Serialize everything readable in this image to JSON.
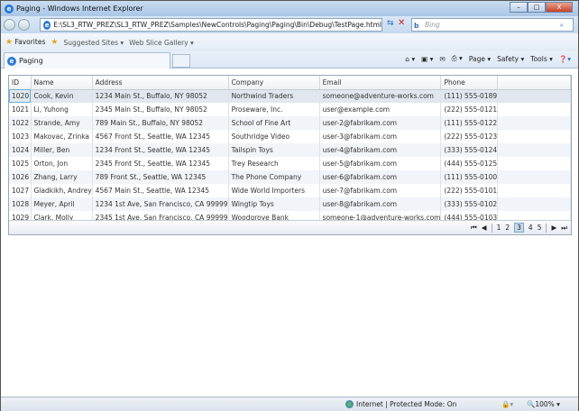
{
  "window": {
    "title": "Paging - Windows Internet Explorer",
    "min": "–",
    "max": "□",
    "close": "X"
  },
  "address": {
    "url": "E:\\SL3_RTW_PREZ\\SL3_RTW_PREZ\\Samples\\NewControls\\Paging\\Paging\\Bin\\Debug\\TestPage.html",
    "search_placeholder": "Bing"
  },
  "favorites": {
    "label": "Favorites",
    "items": [
      "Suggested Sites ▾",
      "Web Slice Gallery ▾"
    ]
  },
  "tab": {
    "label": "Paging"
  },
  "commandbar": [
    "Page ▾",
    "Safety ▾",
    "Tools ▾"
  ],
  "grid": {
    "columns": [
      "ID",
      "Name",
      "Address",
      "Company",
      "Email",
      "Phone"
    ],
    "rows": [
      [
        "1020",
        "Cook, Kevin",
        "1234 Main St., Buffalo, NY 98052",
        "Northwind Traders",
        "someone@adventure-works.com",
        "(111) 555-0189"
      ],
      [
        "1021",
        "Li, Yuhong",
        "2345 Main St., Buffalo, NY 98052",
        "Proseware, Inc.",
        "user@example.com",
        "(222) 555-0121"
      ],
      [
        "1022",
        "Strande, Amy",
        "789 Main St., Buffalo, NY 98052",
        "School of Fine Art",
        "user-2@fabrikam.com",
        "(111) 555-0122"
      ],
      [
        "1023",
        "Makovac, Zrinka",
        "4567 Front St., Seattle, WA 12345",
        "Southridge Video",
        "user-3@fabrikam.com",
        "(222) 555-0123"
      ],
      [
        "1024",
        "Miller, Ben",
        "1234 Front St., Seattle, WA 12345",
        "Tailspin Toys",
        "user-4@fabrikam.com",
        "(333) 555-0124"
      ],
      [
        "1025",
        "Orton, Jon",
        "2345 Front St., Seattle, WA 12345",
        "Trey Research",
        "user-5@fabrikam.com",
        "(444) 555-0125"
      ],
      [
        "1026",
        "Zhang, Larry",
        "789 Front St., Seattle, WA 12345",
        "The Phone Company",
        "user-6@fabrikam.com",
        "(111) 555-0100"
      ],
      [
        "1027",
        "Gladkikh, Andrey",
        "4567 Main St., Seattle, WA 12345",
        "Wide World Importers",
        "user-7@fabrikam.com",
        "(222) 555-0101"
      ],
      [
        "1028",
        "Meyer, April",
        "1234 1st Ave, San Francisco, CA 99999",
        "Wingtip Toys",
        "user-8@fabrikam.com",
        "(333) 555-0102"
      ],
      [
        "1029",
        "Clark, Molly",
        "2345 1st Ave, San Francisco, CA 99999",
        "Woodgrove Bank",
        "someone-1@adventure-works.com",
        "(444) 555-0103"
      ]
    ]
  },
  "pager": {
    "first": "⏮",
    "prev": "◀",
    "pages": [
      "1",
      "2",
      "3",
      "4",
      "5"
    ],
    "current_page": "3",
    "next": "▶",
    "last": "⏭"
  },
  "status": {
    "zone": "Internet | Protected Mode: On",
    "zoom": "100%"
  }
}
